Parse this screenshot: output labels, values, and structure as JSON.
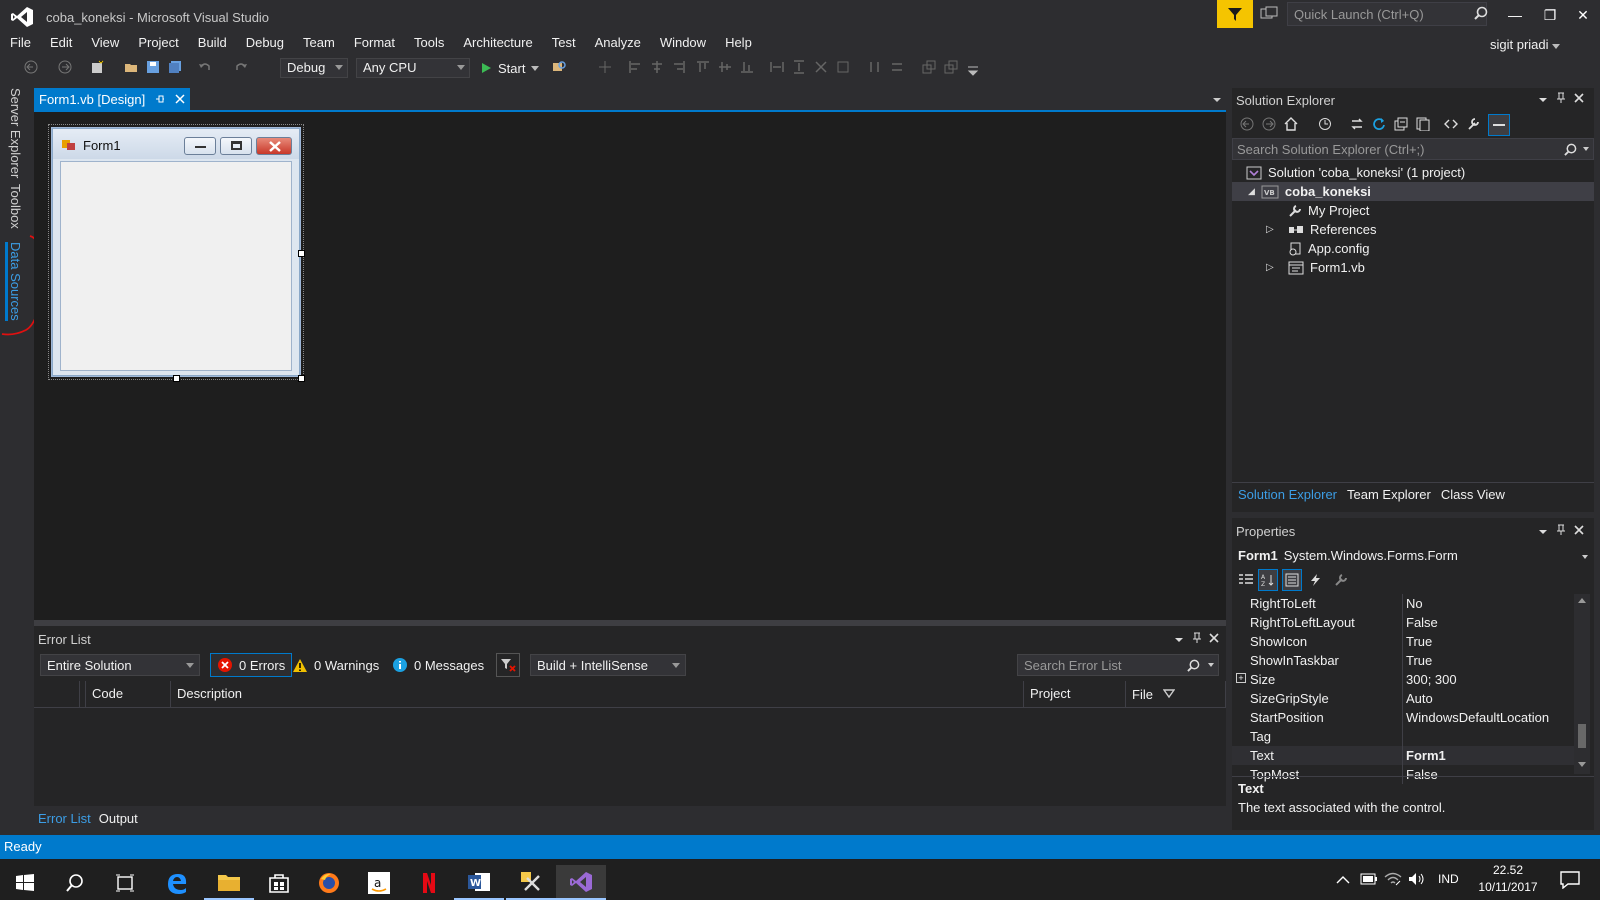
{
  "window": {
    "title": "coba_koneksi - Microsoft Visual Studio",
    "quick_launch_placeholder": "Quick Launch (Ctrl+Q)",
    "user": "sigit priadi"
  },
  "menu": [
    "File",
    "Edit",
    "View",
    "Project",
    "Build",
    "Debug",
    "Team",
    "Format",
    "Tools",
    "Architecture",
    "Test",
    "Analyze",
    "Window",
    "Help"
  ],
  "toolbar": {
    "config": "Debug",
    "platform": "Any CPU",
    "start_label": "Start"
  },
  "side_tabs": [
    "Server Explorer",
    "Toolbox",
    "Data Sources"
  ],
  "document_tab": {
    "label": "Form1.vb [Design]"
  },
  "designer": {
    "form_title": "Form1"
  },
  "error_list": {
    "title": "Error List",
    "scope": "Entire Solution",
    "errors": "0 Errors",
    "warnings": "0 Warnings",
    "messages": "0 Messages",
    "build_filter": "Build + IntelliSense",
    "search_placeholder": "Search Error List",
    "columns": [
      "Code",
      "Description",
      "Project",
      "File"
    ]
  },
  "bottom_tabs": [
    "Error List",
    "Output"
  ],
  "solution_explorer": {
    "title": "Solution Explorer",
    "search_placeholder": "Search Solution Explorer (Ctrl+;)",
    "items": [
      {
        "label": "Solution 'coba_koneksi' (1 project)"
      },
      {
        "label": "coba_koneksi"
      },
      {
        "label": "My Project"
      },
      {
        "label": "References"
      },
      {
        "label": "App.config"
      },
      {
        "label": "Form1.vb"
      }
    ],
    "tabs": [
      "Solution Explorer",
      "Team Explorer",
      "Class View"
    ]
  },
  "properties": {
    "title": "Properties",
    "object_name": "Form1",
    "object_type": "System.Windows.Forms.Form",
    "rows": [
      {
        "name": "RightToLeft",
        "value": "No"
      },
      {
        "name": "RightToLeftLayout",
        "value": "False"
      },
      {
        "name": "ShowIcon",
        "value": "True"
      },
      {
        "name": "ShowInTaskbar",
        "value": "True"
      },
      {
        "name": "Size",
        "value": "300; 300"
      },
      {
        "name": "SizeGripStyle",
        "value": "Auto"
      },
      {
        "name": "StartPosition",
        "value": "WindowsDefaultLocation"
      },
      {
        "name": "Tag",
        "value": ""
      },
      {
        "name": "Text",
        "value": "Form1"
      },
      {
        "name": "TopMost",
        "value": "False"
      }
    ],
    "desc_title": "Text",
    "desc_text": "The text associated with the control."
  },
  "status": {
    "text": "Ready"
  },
  "taskbar": {
    "language": "IND",
    "time": "22.52",
    "date": "10/11/2017"
  },
  "colors": {
    "accent": "#007acc",
    "background": "#2d2d30",
    "editor": "#1e1e1e",
    "filter_yellow": "#f5c400",
    "annotation_red": "#e01010"
  }
}
